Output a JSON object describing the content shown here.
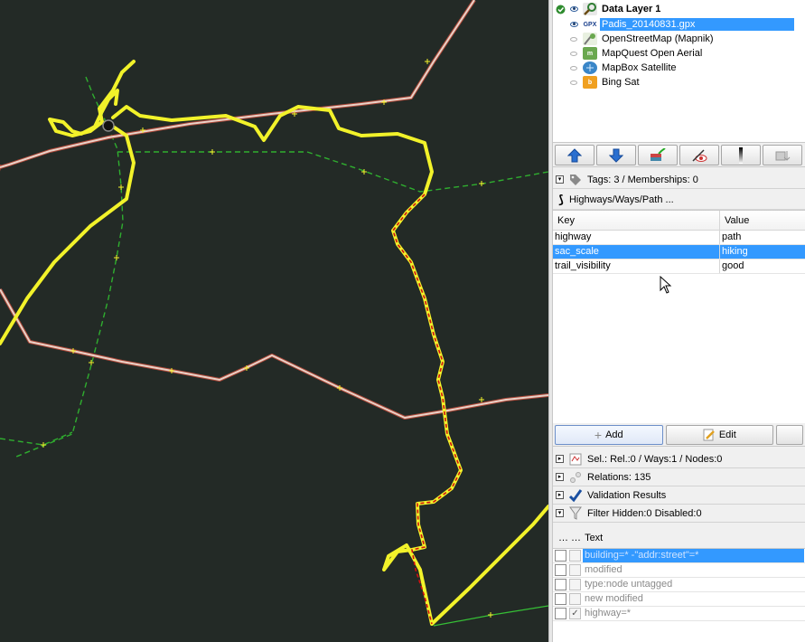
{
  "layers": [
    {
      "name": "Data Layer 1",
      "bold": true,
      "active": true,
      "visible": true,
      "icon": "data-layer-icon",
      "color": "#2e7d32"
    },
    {
      "name": "Padis_20140831.gpx",
      "selected": true,
      "visible": true,
      "icon": "gpx-icon",
      "color": "#1a3f8c"
    },
    {
      "name": "OpenStreetMap (Mapnik)",
      "visible": false,
      "icon": "imagery-icon",
      "color": "#6aa84f"
    },
    {
      "name": "MapQuest Open Aerial",
      "visible": false,
      "icon": "imagery-icon",
      "color": "#6aa84f"
    },
    {
      "name": "MapBox Satellite",
      "visible": false,
      "icon": "globe-icon",
      "color": "#3a86c8"
    },
    {
      "name": "Bing Sat",
      "visible": false,
      "icon": "bing-icon",
      "color": "#f0a020"
    }
  ],
  "layer_toolbar": [
    "move-up-icon",
    "move-down-icon",
    "merge-icon",
    "toggle-visibility-icon",
    "opacity-icon",
    "delete-layer-icon"
  ],
  "tags": {
    "header": "Tags: 3 / Memberships: 0",
    "subheader": "Highways/Ways/Path ...",
    "col_key": "Key",
    "col_value": "Value",
    "rows": [
      {
        "key": "highway",
        "value": "path"
      },
      {
        "key": "sac_scale",
        "value": "hiking",
        "selected": true
      },
      {
        "key": "trail_visibility",
        "value": "good"
      }
    ],
    "add_label": "Add",
    "edit_label": "Edit"
  },
  "selection": {
    "header": "Sel.: Rel.:0 / Ways:1 / Nodes:0"
  },
  "relations": {
    "header": "Relations: 135"
  },
  "validation": {
    "header": "Validation Results"
  },
  "filter": {
    "header": "Filter Hidden:0 Disabled:0",
    "col_text": "Text",
    "col_prefix": "… …",
    "rows": [
      {
        "text": "building=* -\"addr:street\"=*",
        "selected": true,
        "checked": false
      },
      {
        "text": "modified",
        "checked": false
      },
      {
        "text": "type:node untagged",
        "checked": false
      },
      {
        "text": "new modified",
        "checked": false
      },
      {
        "text": "highway=*",
        "checked": true
      }
    ]
  },
  "colors": {
    "map_bg": "#232a26",
    "gpx_track": "#f2f22a",
    "way_fill": "#e8d2c8",
    "way_border": "#b04a3a",
    "selected_way": "#d01010",
    "footpath": "#2fae2f",
    "selection": "#3399ff"
  }
}
